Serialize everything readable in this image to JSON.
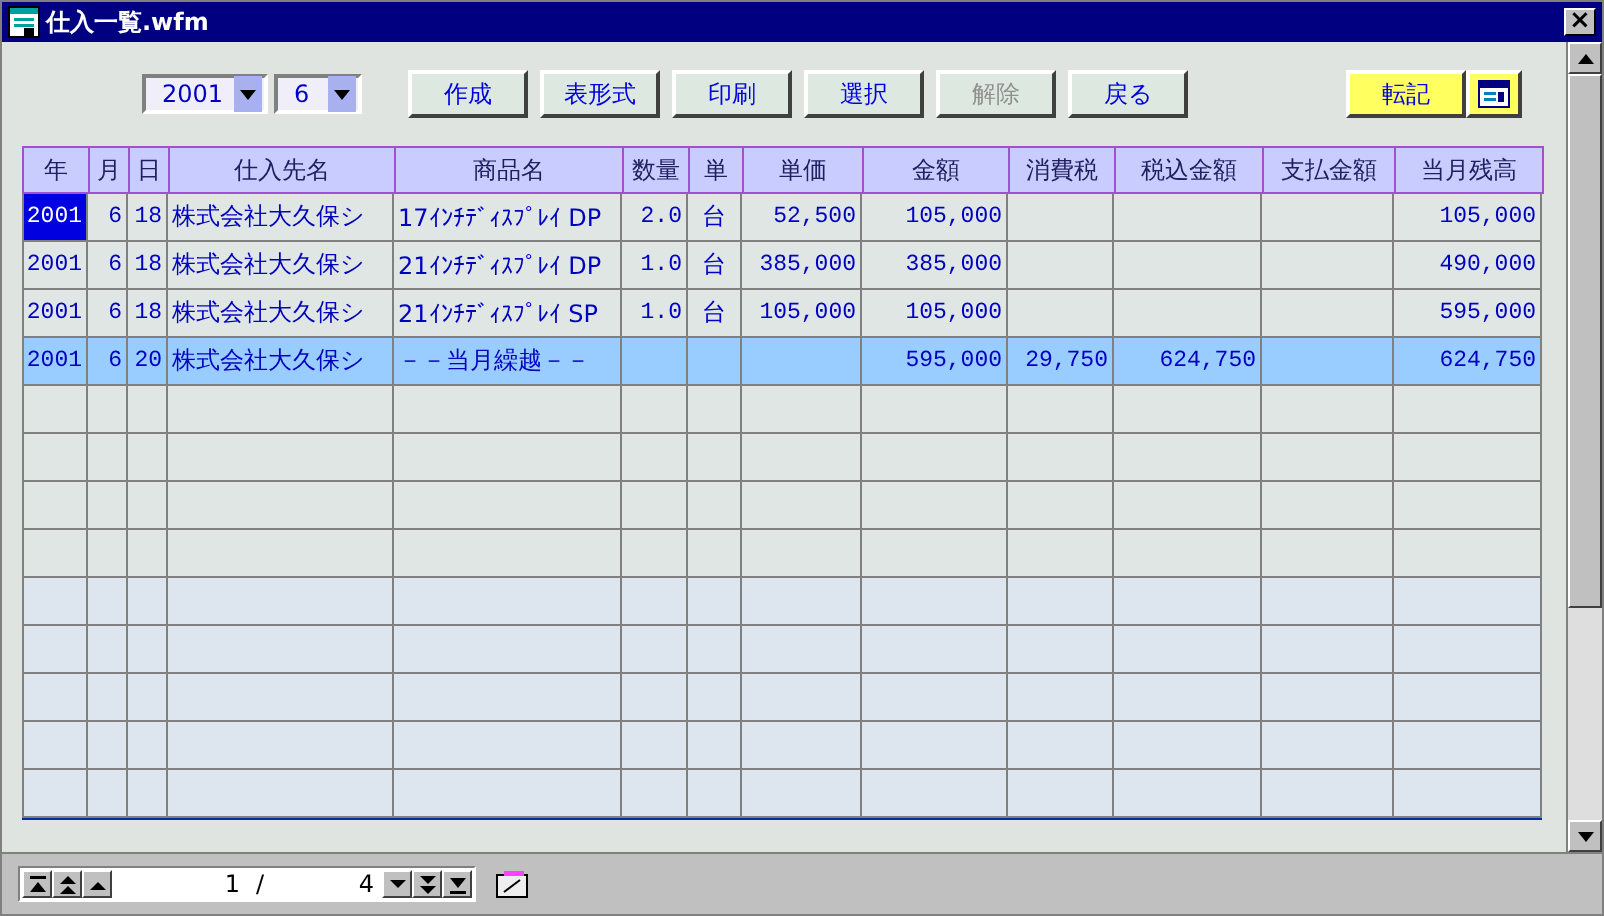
{
  "window": {
    "title": "仕入一覧.wfm",
    "close": "×"
  },
  "filters": [
    {
      "value": "2001"
    },
    {
      "value": "6"
    }
  ],
  "buttons": [
    {
      "label": "作成",
      "disabled": false
    },
    {
      "label": "表形式",
      "disabled": false
    },
    {
      "label": "印刷",
      "disabled": false
    },
    {
      "label": "選択",
      "disabled": false
    },
    {
      "label": "解除",
      "disabled": true
    },
    {
      "label": "戻る",
      "disabled": false
    }
  ],
  "post_button": {
    "label": "転記"
  },
  "table": {
    "columns": [
      "年",
      "月",
      "日",
      "仕入先名",
      "商品名",
      "数量",
      "単",
      "単価",
      "金額",
      "消費税",
      "税込金額",
      "支払金額",
      "当月残高"
    ],
    "rows": [
      {
        "cells": [
          "2001",
          "6",
          "18",
          "株式会社大久保シ",
          "17ｲﾝﾁﾃﾞｨｽﾌﾟﾚｲ DP",
          "2.0",
          "台",
          "52,500",
          "105,000",
          "",
          "",
          "",
          "105,000"
        ],
        "selected": false,
        "focused": true
      },
      {
        "cells": [
          "2001",
          "6",
          "18",
          "株式会社大久保シ",
          "21ｲﾝﾁﾃﾞｨｽﾌﾟﾚｲ DP",
          "1.0",
          "台",
          "385,000",
          "385,000",
          "",
          "",
          "",
          "490,000"
        ],
        "selected": false,
        "focused": false
      },
      {
        "cells": [
          "2001",
          "6",
          "18",
          "株式会社大久保シ",
          "21ｲﾝﾁﾃﾞｨｽﾌﾟﾚｲ SP",
          "1.0",
          "台",
          "105,000",
          "105,000",
          "",
          "",
          "",
          "595,000"
        ],
        "selected": false,
        "focused": false
      },
      {
        "cells": [
          "2001",
          "6",
          "20",
          "株式会社大久保シ",
          "－－当月繰越－－",
          "",
          "",
          "",
          "595,000",
          "29,750",
          "624,750",
          "",
          "624,750"
        ],
        "selected": true,
        "focused": false
      }
    ]
  },
  "pager": {
    "current": "1",
    "separator": "/",
    "total": "4"
  }
}
